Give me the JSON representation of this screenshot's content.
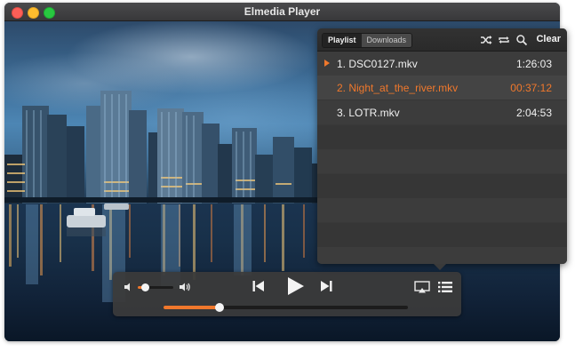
{
  "window": {
    "title": "Elmedia Player"
  },
  "playlist": {
    "tabs": [
      {
        "label": "Playlist",
        "active": true
      },
      {
        "label": "Downloads",
        "active": false
      }
    ],
    "header_icons": [
      "shuffle-icon",
      "repeat-icon",
      "search-icon"
    ],
    "clear_label": "Clear",
    "items": [
      {
        "name": "1. DSC0127.mkv",
        "duration": "1:26:03",
        "current": false,
        "marked": true
      },
      {
        "name": "2. Night_at_the_river.mkv",
        "duration": "00:37:12",
        "current": true,
        "marked": false
      },
      {
        "name": "3. LOTR.mkv",
        "duration": "2:04:53",
        "current": false,
        "marked": false
      }
    ]
  },
  "controls": {
    "volume_level": 0.2,
    "playback_progress": 0.23,
    "icons": [
      "volume-low-icon",
      "volume-high-icon",
      "previous-track-icon",
      "play-icon",
      "next-track-icon",
      "airplay-icon",
      "playlist-icon"
    ]
  },
  "colors": {
    "accent": "#f0782c",
    "panel": "#3a3a3a",
    "titlebar": "#3f3f41"
  }
}
